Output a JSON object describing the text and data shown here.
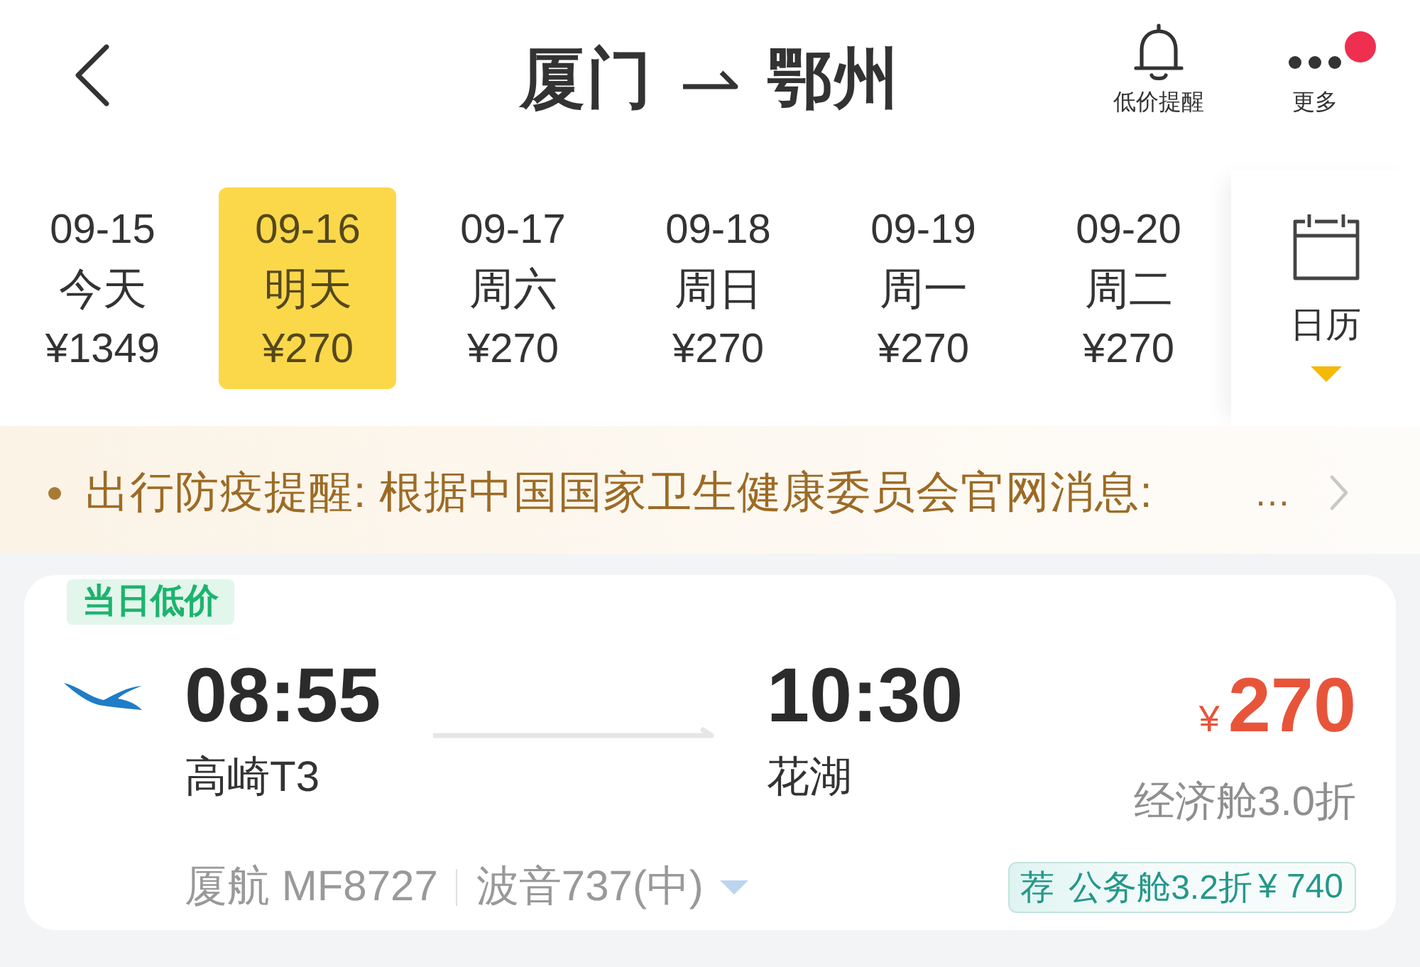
{
  "header": {
    "origin": "厦门",
    "destination": "鄂州",
    "actions": [
      {
        "kind": "bell",
        "label": "低价提醒",
        "dot": false
      },
      {
        "kind": "more",
        "label": "更多",
        "dot": true
      }
    ]
  },
  "dates": [
    {
      "date": "09-15",
      "weekday": "今天",
      "price": "¥1349",
      "selected": false
    },
    {
      "date": "09-16",
      "weekday": "明天",
      "price": "¥270",
      "selected": true
    },
    {
      "date": "09-17",
      "weekday": "周六",
      "price": "¥270",
      "selected": false
    },
    {
      "date": "09-18",
      "weekday": "周日",
      "price": "¥270",
      "selected": false
    },
    {
      "date": "09-19",
      "weekday": "周一",
      "price": "¥270",
      "selected": false
    },
    {
      "date": "09-20",
      "weekday": "周二",
      "price": "¥270",
      "selected": false
    }
  ],
  "calendar": {
    "label": "日历"
  },
  "notice": {
    "text": "出行防疫提醒: 根据中国国家卫生健康委员会官网消息:",
    "more": "…"
  },
  "flight": {
    "tag": "当日低价",
    "departure": {
      "time": "08:55",
      "airport": "高崎T3"
    },
    "arrival": {
      "time": "10:30",
      "airport": "花湖"
    },
    "currency": "¥",
    "price": "270",
    "fare_note": "经济舱3.0折",
    "flight_number": "厦航 MF8727",
    "aircraft": "波音737(中)",
    "offer": {
      "badge": "荐",
      "text": "公务舱3.2折",
      "price": "¥ 740"
    }
  }
}
